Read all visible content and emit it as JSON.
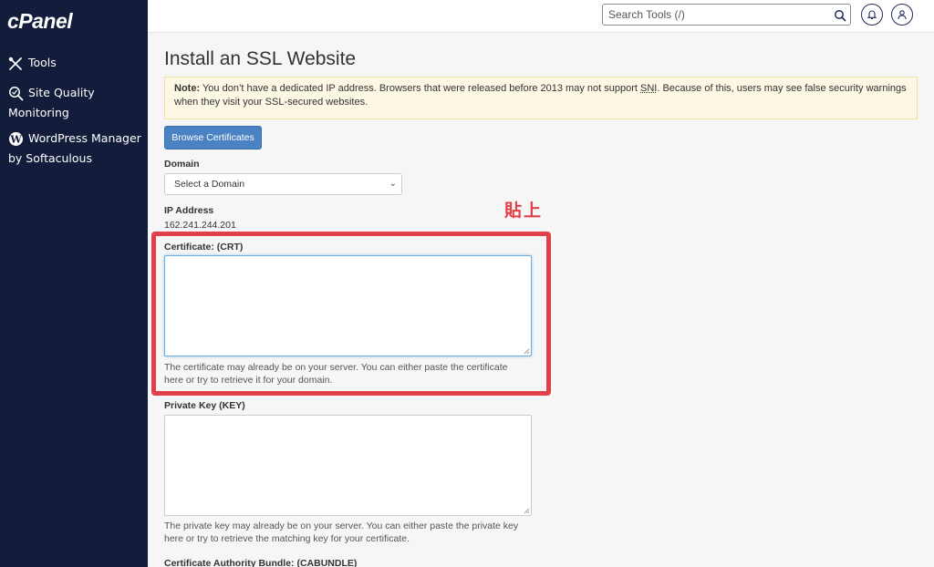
{
  "sidebar": {
    "logo": "cPanel",
    "items": [
      {
        "label": "Tools",
        "icon": "tools-icon"
      },
      {
        "label": "Site Quality",
        "label2": "Monitoring",
        "icon": "magnifier-icon"
      },
      {
        "label": "WordPress Manager",
        "label2": "by Softaculous",
        "icon": "wordpress-icon"
      }
    ]
  },
  "topbar": {
    "search_placeholder": "Search Tools (/)"
  },
  "main": {
    "title": "Install an SSL Website",
    "note_label": "Note:",
    "note_text_1": " You don’t have a dedicated IP address. Browsers that were released before 2013 may not support ",
    "note_abbr": "SNI",
    "note_text_2": ". Because of this, users may see false security warnings when they visit your SSL-secured websites.",
    "browse_button": "Browse Certificates",
    "domain_label": "Domain",
    "domain_select": "Select a Domain",
    "ip_label": "IP Address",
    "ip_value": "162.241.244.201",
    "crt_label": "Certificate: (CRT)",
    "crt_help": "The certificate may already be on your server. You can either paste the certificate here or try to retrieve it for your domain.",
    "key_label": "Private Key (KEY)",
    "key_help": "The private key may already be on your server. You can either paste the private key here or try to retrieve the matching key for your certificate.",
    "cabundle_label": "Certificate Authority Bundle: (CABUNDLE)"
  },
  "annotation": {
    "text": "貼上",
    "color": "#e13f4a"
  },
  "colors": {
    "sidebar_bg": "#131d3b",
    "primary_button": "#4b82c4",
    "note_bg": "#fcf8e3"
  }
}
